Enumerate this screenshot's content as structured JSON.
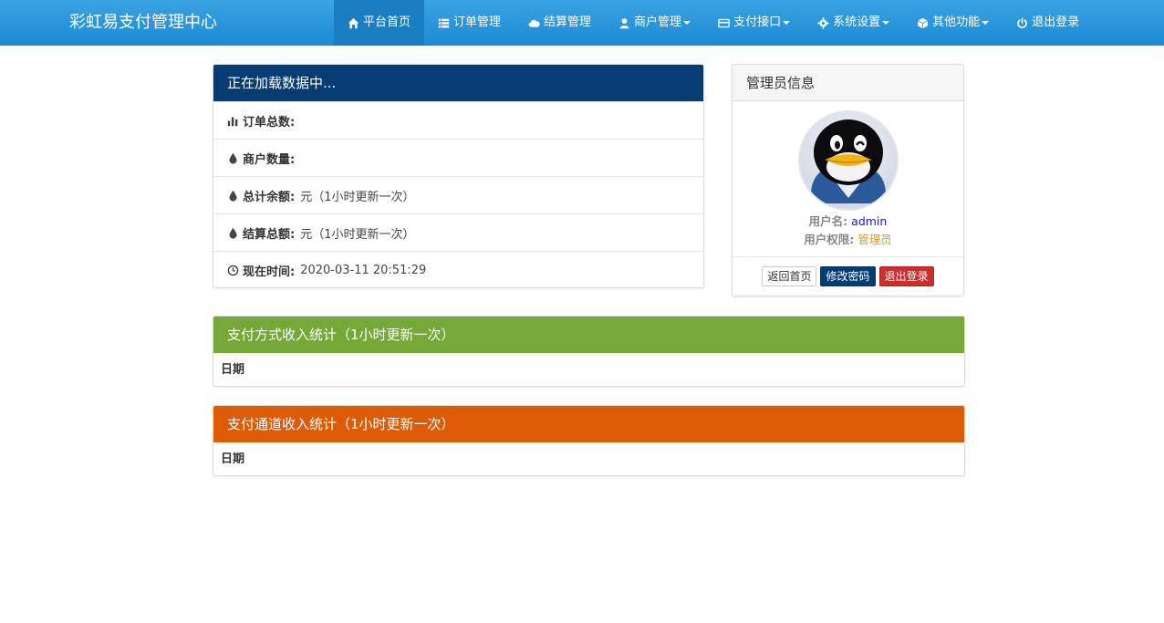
{
  "brand": "彩虹易支付管理中心",
  "nav": [
    {
      "label": "平台首页",
      "icon": "home-icon",
      "active": true
    },
    {
      "label": "订单管理",
      "icon": "list-icon"
    },
    {
      "label": "结算管理",
      "icon": "cloud-icon"
    },
    {
      "label": "商户管理",
      "icon": "user-icon",
      "dropdown": true
    },
    {
      "label": "支付接口",
      "icon": "credit-card-icon",
      "dropdown": true
    },
    {
      "label": "系统设置",
      "icon": "gear-icon",
      "dropdown": true
    },
    {
      "label": "其他功能",
      "icon": "cube-icon",
      "dropdown": true
    },
    {
      "label": "退出登录",
      "icon": "power-icon"
    }
  ],
  "stats": {
    "title": "正在加载数据中...",
    "rows": [
      {
        "icon": "bar-chart-icon",
        "label": "订单总数:",
        "value": ""
      },
      {
        "icon": "tint-icon",
        "label": "商户数量:",
        "value": ""
      },
      {
        "icon": "tint-icon",
        "label": "总计余额:",
        "value": "元（1小时更新一次）"
      },
      {
        "icon": "tint-icon",
        "label": "结算总额:",
        "value": "元（1小时更新一次）"
      },
      {
        "icon": "clock-icon",
        "label": "现在时间:",
        "value": "2020-03-11 20:51:29"
      }
    ]
  },
  "admin": {
    "title": "管理员信息",
    "username_label": "用户名:",
    "username": "admin",
    "role_label": "用户权限:",
    "role": "管理员",
    "buttons": {
      "home": "返回首页",
      "change_password": "修改密码",
      "logout": "退出登录"
    }
  },
  "pay_type_stats": {
    "title": "支付方式收入统计（1小时更新一次）",
    "column": "日期"
  },
  "channel_stats": {
    "title": "支付通道收入统计（1小时更新一次）",
    "column": "日期"
  },
  "colors": {
    "nav": "#1d8ad3",
    "primary": "#063c74",
    "success": "#74a837",
    "warning": "#de5b05",
    "danger": "#c9302c"
  }
}
